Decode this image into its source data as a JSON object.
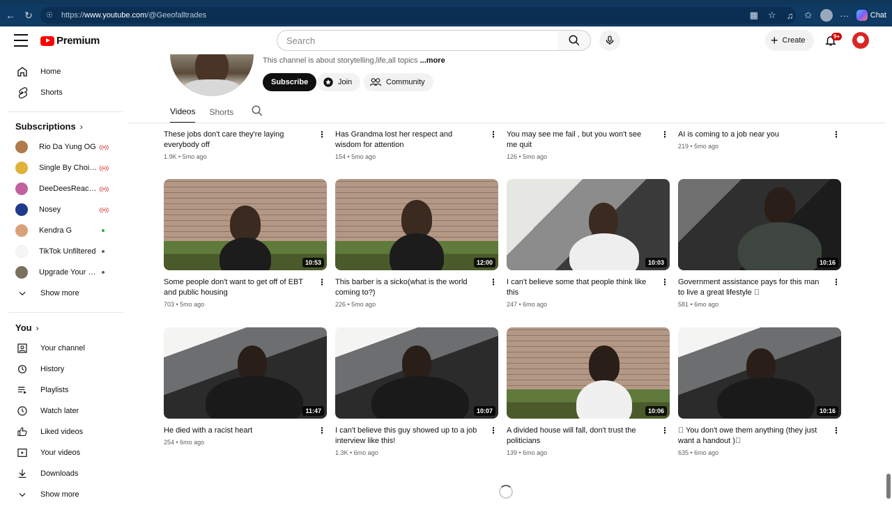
{
  "browser": {
    "url_prefix": "https://",
    "url_host": "www.youtube.com",
    "url_path": "/@Geeofalltrades",
    "chat_label": "Chat"
  },
  "header": {
    "logo_text": "Premium",
    "search_placeholder": "Search",
    "create_label": "Create",
    "notifications_badge": "9+"
  },
  "sidebar": {
    "main": [
      {
        "label": "Home",
        "icon": "home-icon"
      },
      {
        "label": "Shorts",
        "icon": "shorts-icon"
      }
    ],
    "subscriptions_title": "Subscriptions",
    "subscriptions": [
      {
        "label": "Rio Da Yung OG",
        "status": "live",
        "color": "#b07a4a"
      },
      {
        "label": "Single By Choice...",
        "status": "live",
        "color": "#e0b23a"
      },
      {
        "label": "DeeDeesReactio...",
        "status": "live",
        "color": "#c060a0"
      },
      {
        "label": "Nosey",
        "status": "live",
        "color": "#1e3a8a"
      },
      {
        "label": "Kendra G",
        "status": "new",
        "color": "#d9a07a"
      },
      {
        "label": "TikTok Unfiltered",
        "status": "dot",
        "color": "#f5f5f5"
      },
      {
        "label": "Upgrade Your Life",
        "status": "dot",
        "color": "#7a7060"
      }
    ],
    "subs_show_more": "Show more",
    "you_title": "You",
    "you_items": [
      {
        "label": "Your channel",
        "icon": "your-channel-icon"
      },
      {
        "label": "History",
        "icon": "history-icon"
      },
      {
        "label": "Playlists",
        "icon": "playlists-icon"
      },
      {
        "label": "Watch later",
        "icon": "watch-later-icon"
      },
      {
        "label": "Liked videos",
        "icon": "liked-icon"
      },
      {
        "label": "Your videos",
        "icon": "your-videos-icon"
      },
      {
        "label": "Downloads",
        "icon": "downloads-icon"
      }
    ],
    "you_show_more": "Show more"
  },
  "channel": {
    "description": "This channel is about storytelling,life,all topics",
    "more_label": "...more",
    "subscribe_label": "Subscribe",
    "join_label": "Join",
    "community_label": "Community",
    "tabs": [
      "Videos",
      "Shorts"
    ]
  },
  "videos": [
    {
      "title": "These jobs don't care they're laying everybody off",
      "meta": "1.9K • 5mo ago",
      "duration": ""
    },
    {
      "title": "Has Grandma lost her respect and wisdom for attention",
      "meta": "154 • 5mo ago",
      "duration": ""
    },
    {
      "title": "You may see me fail , but you won't see me quit",
      "meta": "126 • 5mo ago",
      "duration": ""
    },
    {
      "title": "AI is coming to a job near you",
      "meta": "219 • 5mo ago",
      "duration": ""
    },
    {
      "title": "Some people don't want to get off of EBT and public housing",
      "meta": "703 • 5mo ago",
      "duration": "10:53"
    },
    {
      "title": "This barber is a sicko(what is the world coming to?)",
      "meta": "226 • 5mo ago",
      "duration": "12:00"
    },
    {
      "title": "I can't believe some that people think like this",
      "meta": "247 • 6mo ago",
      "duration": "10:03"
    },
    {
      "title": "Government assistance pays for this man to live a great lifestyle \u0000",
      "meta": "581 • 6mo ago",
      "duration": "10:16"
    },
    {
      "title": "He died with a racist heart",
      "meta": "254 • 6mo ago",
      "duration": "11:47"
    },
    {
      "title": "I can't believe this guy showed up to a job interview like this!",
      "meta": "1.3K • 6mo ago",
      "duration": "10:07"
    },
    {
      "title": "A divided house will fall, don't trust the politicians",
      "meta": "139 • 6mo ago",
      "duration": "10:06"
    },
    {
      "title": "\u0000 You don't owe them anything (they just want a handout )\u0000",
      "meta": "635 • 6mo ago",
      "duration": "10:16"
    }
  ]
}
